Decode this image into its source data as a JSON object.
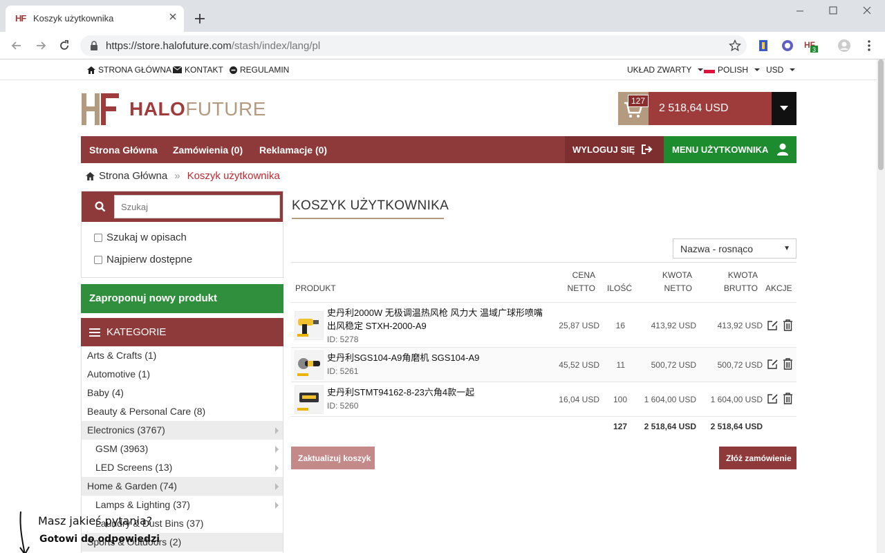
{
  "browser": {
    "tab_title": "Koszyk użytkownika",
    "tab_favicon": "HF",
    "url_host": "https://store.halofuture.com",
    "url_path": "/stash/index/lang/pl"
  },
  "topnav": {
    "home": "STRONA GŁÓWNA",
    "contact": "KONTAKT",
    "terms": "REGULAMIN",
    "layout": "UKŁAD ZWARTY",
    "language": "POLISH",
    "currency": "USD"
  },
  "logo": {
    "mark": "HF",
    "text_bold": "HALO",
    "text_light": "FUTURE"
  },
  "cart": {
    "count": "127",
    "total": "2 518,64 USD"
  },
  "mainnav": {
    "home": "Strona Główna",
    "orders": "Zamówienia (0)",
    "complaints": "Reklamacje (0)",
    "logout": "WYLOGUJ SIĘ",
    "user_menu": "MENU UŻYTKOWNIKA"
  },
  "breadcrumb": {
    "home": "Strona Główna",
    "sep": "»",
    "current": "Koszyk użytkownika"
  },
  "sidebar": {
    "search_placeholder": "Szukaj",
    "check_desc": "Szukaj w opisach",
    "check_avail": "Najpierw dostępne",
    "suggest": "Zaproponuj nowy produkt",
    "categories_title": "KATEGORIE",
    "categories": [
      {
        "label": "Arts & Crafts (1)"
      },
      {
        "label": "Automotive (1)"
      },
      {
        "label": "Baby (4)"
      },
      {
        "label": "Beauty & Personal Care (8)"
      },
      {
        "label": "Electronics (3767)"
      },
      {
        "label": "GSM (3963)"
      },
      {
        "label": "LED Screens (13)"
      },
      {
        "label": "Home & Garden (74)"
      },
      {
        "label": "Lamps & Lighting (37)"
      },
      {
        "label": "Laundry & Dust Bins (37)"
      },
      {
        "label": "Sports & Outdoors (2)"
      }
    ]
  },
  "main": {
    "title": "KOSZYK UŻYTKOWNIKA",
    "sort": "Nazwa - rosnąco",
    "headers": {
      "product": "PRODUKT",
      "price1": "CENA",
      "price2": "NETTO",
      "qty": "ILOŚĆ",
      "net1": "KWOTA",
      "net2": "NETTO",
      "gross1": "KWOTA",
      "gross2": "BRUTTO",
      "actions": "AKCJE"
    },
    "rows": [
      {
        "name1": "史丹利2000W 无极调温热风枪 风力大 温域广球形喷嘴",
        "name2": "出风稳定 STXH-2000-A9",
        "id": "ID: 5278",
        "price": "25,87 USD",
        "qty": "16",
        "net": "413,92 USD",
        "gross": "413,92 USD"
      },
      {
        "name1": "史丹利SGS104-A9角磨机 SGS104-A9",
        "name2": "",
        "id": "ID: 5261",
        "price": "45,52 USD",
        "qty": "11",
        "net": "500,72 USD",
        "gross": "500,72 USD"
      },
      {
        "name1": "史丹利STMT94162-8-23六角4款一起",
        "name2": "",
        "id": "ID: 5260",
        "price": "16,04 USD",
        "qty": "100",
        "net": "1 604,00 USD",
        "gross": "1 604,00 USD"
      }
    ],
    "totals": {
      "qty": "127",
      "net": "2 518,64 USD",
      "gross": "2 518,64 USD"
    },
    "update_button": "Zaktualizuj koszyk",
    "order_button": "Złóż zamówienie"
  },
  "chat": {
    "question": "Masz jakieś pytania?",
    "answer": "Gotowi do odpowiedzi"
  }
}
